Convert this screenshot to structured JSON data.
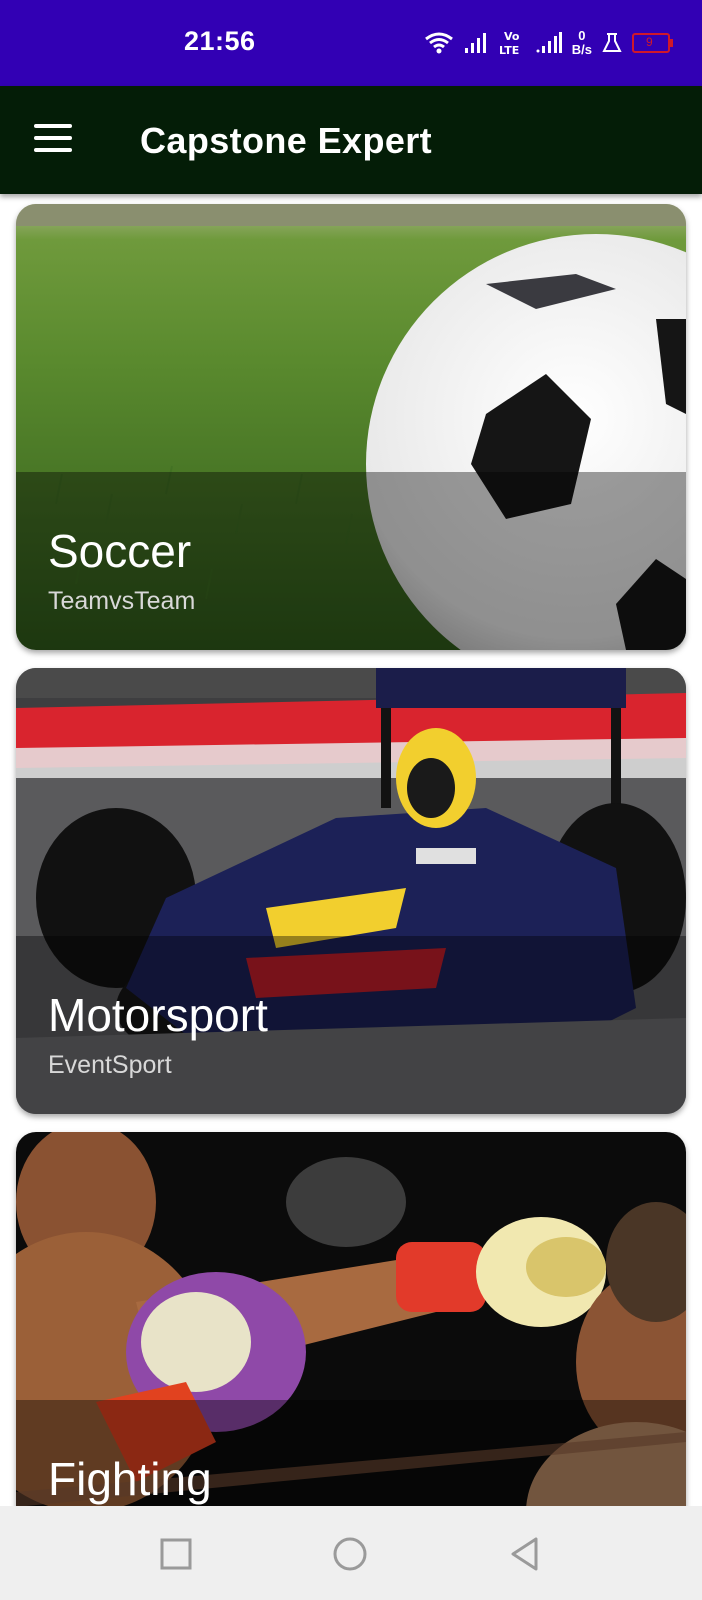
{
  "status_bar": {
    "time": "21:56",
    "net_speed_value": "0",
    "net_speed_unit": "B/s",
    "battery_level": "9",
    "icons": [
      "wifi-icon",
      "signal-icon",
      "volte-icon",
      "signal-icon",
      "lab-flask-icon",
      "battery-icon"
    ]
  },
  "app_bar": {
    "title": "Capstone Expert",
    "menu_icon": "hamburger-menu-icon",
    "background": "#041d07"
  },
  "sports": [
    {
      "title": "Soccer",
      "subtitle": "TeamvsTeam",
      "image": "soccer-ball-on-grass"
    },
    {
      "title": "Motorsport",
      "subtitle": "EventSport",
      "image": "formula-one-car"
    },
    {
      "title": "Fighting",
      "subtitle": "",
      "image": "boxing-match"
    }
  ],
  "nav_bar": {
    "buttons": [
      "recent-apps-icon",
      "home-icon",
      "back-icon"
    ]
  },
  "colors": {
    "status_bar": "#3200b4",
    "app_bar": "#041d07",
    "nav_bar": "#efefef"
  }
}
